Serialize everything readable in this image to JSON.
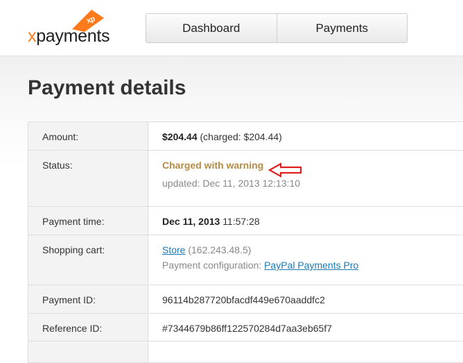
{
  "logo": {
    "text_x": "x",
    "text_rest": "payments",
    "badge": "xp"
  },
  "nav": {
    "items": [
      {
        "label": "Dashboard"
      },
      {
        "label": "Payments"
      }
    ]
  },
  "page": {
    "title": "Payment details"
  },
  "details": {
    "amount": {
      "label": "Amount:",
      "value": "$204.44",
      "charged": "(charged: $204.44)"
    },
    "status": {
      "label": "Status:",
      "value": "Charged with warning",
      "updated": "updated: Dec 11, 2013 12:13:10"
    },
    "payment_time": {
      "label": "Payment time:",
      "date": "Dec 11, 2013",
      "time": "11:57:28"
    },
    "shopping_cart": {
      "label": "Shopping cart:",
      "store_link": "Store",
      "store_ip": "(162.243.48.5)",
      "config_label": "Payment configuration:",
      "config_link": "PayPal Payments Pro"
    },
    "payment_id": {
      "label": "Payment ID:",
      "value": "96114b287720bfacdf449e670aaddfc2"
    },
    "reference_id": {
      "label": "Reference ID:",
      "value": "#7344679b86ff122570284d7aa3eb65f7"
    }
  },
  "colors": {
    "accent": "#ff7a1a",
    "warning_text": "#b58a44",
    "link": "#1a78b5",
    "annotation_arrow": "#e0201e"
  }
}
